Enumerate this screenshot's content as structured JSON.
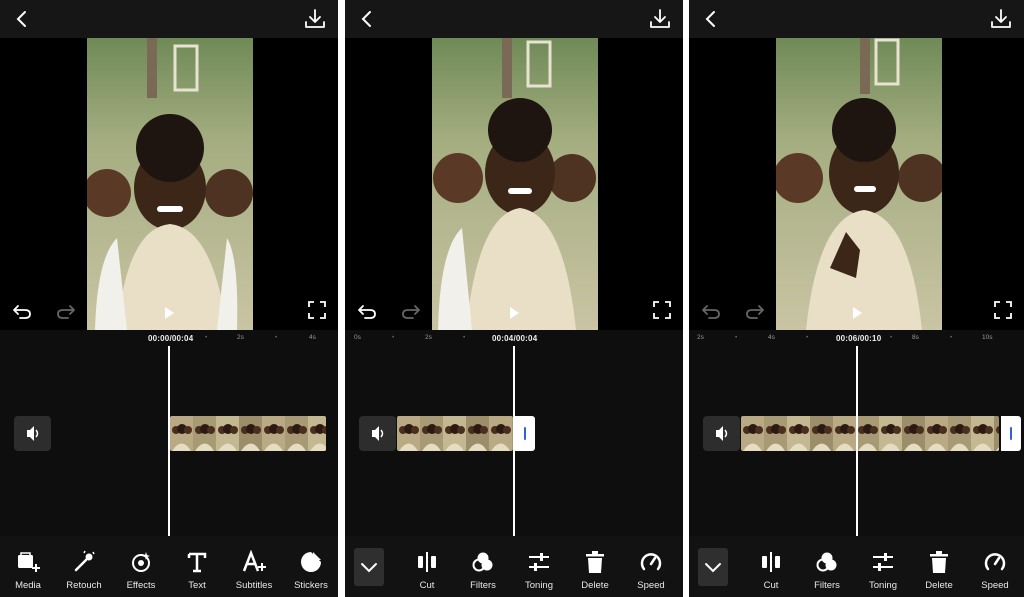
{
  "screens": [
    {
      "id": "main-edit",
      "timecode": "00:00/00:04",
      "ruler": [
        "2s",
        "4s"
      ],
      "tools": [
        "Media",
        "Retouch",
        "Effects",
        "Text",
        "Subtitles",
        "Stickers"
      ]
    },
    {
      "id": "clip-edit-1",
      "timecode": "00:04/00:04",
      "ruler": [
        "0s",
        "2s"
      ],
      "tools": [
        "Cut",
        "Filters",
        "Toning",
        "Delete",
        "Speed"
      ]
    },
    {
      "id": "clip-edit-2",
      "timecode": "00:06/00:10",
      "ruler": [
        "2s",
        "4s",
        "8s",
        "10s"
      ],
      "tools": [
        "Cut",
        "Filters",
        "Toning",
        "Delete",
        "Speed"
      ]
    }
  ],
  "colors": {
    "background": "#0e0e0e",
    "toolbar": "#121212",
    "accent": "#3060e0"
  },
  "icons": [
    "back-arrow-icon",
    "download-icon",
    "undo-icon",
    "redo-icon",
    "fullscreen-icon",
    "play-icon",
    "volume-icon",
    "collapse-chevron-icon"
  ]
}
